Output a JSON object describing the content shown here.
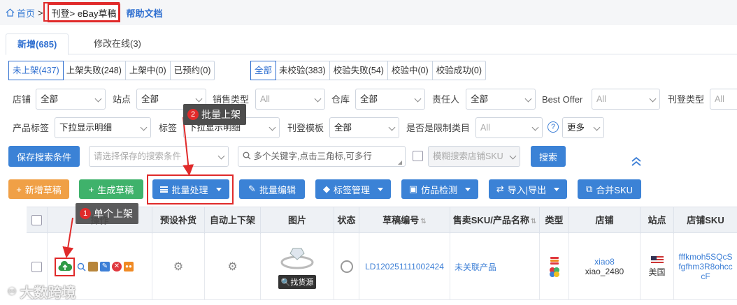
{
  "breadcrumb": {
    "home": "首页",
    "current": "刊登> eBay草稿",
    "help": "帮助文档"
  },
  "tabs": [
    {
      "label": "新增(685)"
    },
    {
      "label": "修改在线(3)"
    }
  ],
  "status_filters": [
    "未上架(437)",
    "上架失败(248)",
    "上架中(0)",
    "已预约(0)"
  ],
  "check_filters": [
    "全部",
    "未校验(383)",
    "校验失败(54)",
    "校验中(0)",
    "校验成功(0)"
  ],
  "filters": {
    "store": {
      "label": "店铺",
      "value": "全部"
    },
    "site": {
      "label": "站点",
      "value": "全部"
    },
    "sale_type": {
      "label": "销售类型",
      "value": "All"
    },
    "warehouse": {
      "label": "仓库",
      "value": "全部"
    },
    "owner": {
      "label": "责任人",
      "value": "全部"
    },
    "best_offer": {
      "label": "Best Offer",
      "value": "All"
    },
    "listing_type": {
      "label": "刊登类型",
      "value": "All"
    },
    "product_tag": {
      "label": "产品标签",
      "value": "下拉显示明细"
    },
    "tag": {
      "label": "标签",
      "value": "下拉显示明细"
    },
    "template": {
      "label": "刊登模板",
      "value": "全部"
    },
    "restricted": {
      "label": "是否是限制类目",
      "value": "All"
    },
    "more": "更多"
  },
  "search": {
    "save_button": "保存搜索条件",
    "saved_placeholder": "请选择保存的搜索条件",
    "keyword_placeholder": "多个关键字,点击三角标,可多行",
    "fuzzy_label": "模糊搜索店铺SKU",
    "search_button": "搜索"
  },
  "toolbar": {
    "add_draft": "新增草稿",
    "gen_draft": "生成草稿",
    "batch": "批量处理",
    "batch_edit": "批量编辑",
    "tag_manage": "标签管理",
    "counterfeit": "仿品检测",
    "import_export": "导入|导出",
    "merge_sku": "合并SKU"
  },
  "callouts": [
    {
      "num": "1",
      "text": "单个上架"
    },
    {
      "num": "2",
      "text": "批量上架"
    }
  ],
  "table": {
    "headers": [
      "操作",
      "预设补货",
      "自动上下架",
      "图片",
      "状态",
      "草稿编号",
      "售卖SKU/产品名称",
      "类型",
      "店铺",
      "站点",
      "店铺SKU"
    ],
    "row": {
      "draft_no": "LD120251111002424",
      "sku": "未关联产品",
      "store_name": "xiao8",
      "store_account": "xiao_2480",
      "site": "美国",
      "store_sku": "fffkmoh5SQcSfgfhm3R8ohcccF",
      "find_source": "找货源"
    }
  },
  "watermark": "大数跨境",
  "colors": {
    "accent": "#3b82d6",
    "highlight": "#e02a2a"
  }
}
